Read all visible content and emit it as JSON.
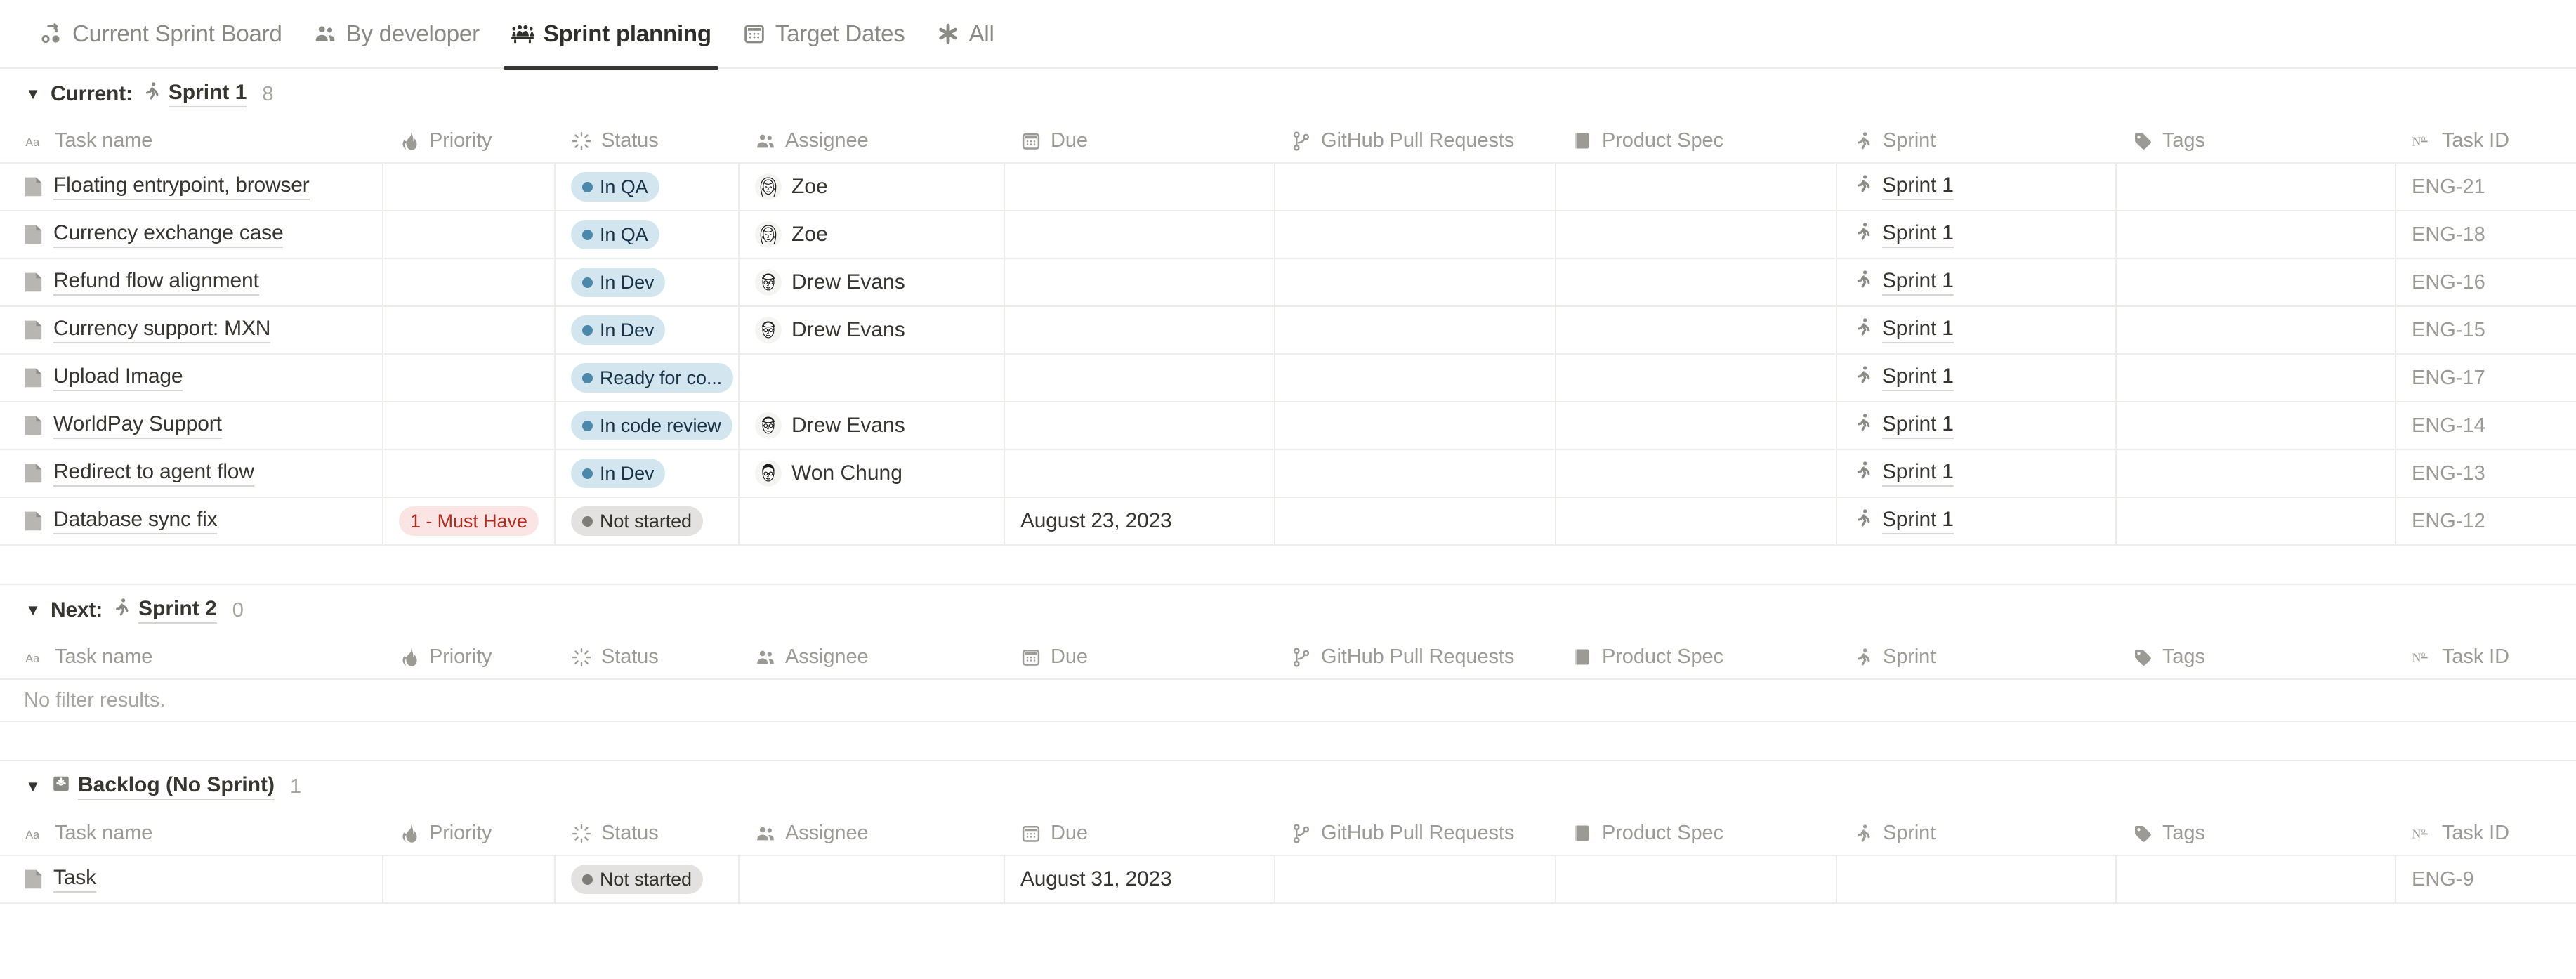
{
  "tabs": [
    {
      "label": "Current Sprint Board",
      "icon": "sprint-board-icon",
      "active": false
    },
    {
      "label": "By developer",
      "icon": "people-icon",
      "active": false
    },
    {
      "label": "Sprint planning",
      "icon": "meeting-icon",
      "active": true
    },
    {
      "label": "Target Dates",
      "icon": "calendar-icon",
      "active": false
    },
    {
      "label": "All",
      "icon": "asterisk-icon",
      "active": false
    }
  ],
  "columns": [
    {
      "key": "name",
      "label": "Task name",
      "icon": "aa-text-icon"
    },
    {
      "key": "priority",
      "label": "Priority",
      "icon": "flame-icon"
    },
    {
      "key": "status",
      "label": "Status",
      "icon": "spinner-icon"
    },
    {
      "key": "assignee",
      "label": "Assignee",
      "icon": "people-icon"
    },
    {
      "key": "due",
      "label": "Due",
      "icon": "calendar-icon"
    },
    {
      "key": "pr",
      "label": "GitHub Pull Requests",
      "icon": "git-branch-icon"
    },
    {
      "key": "spec",
      "label": "Product Spec",
      "icon": "book-icon"
    },
    {
      "key": "sprint",
      "label": "Sprint",
      "icon": "runner-icon"
    },
    {
      "key": "tags",
      "label": "Tags",
      "icon": "tag-icon"
    },
    {
      "key": "taskid",
      "label": "Task ID",
      "icon": "number-icon"
    }
  ],
  "colors": {
    "status_blue_bg": "#d3e5ef",
    "status_blue_text": "#183347",
    "status_blue_dot": "#4b88ab",
    "status_gray_bg": "#e3e2e0",
    "status_gray_text": "#32302c",
    "status_gray_dot": "#7e7d78",
    "priority_red_bg": "#fbe4e4",
    "priority_red_text": "#ad2f24",
    "grid_line": "#edecea",
    "muted_text": "#9b9a95",
    "active_tab": "#37352f"
  },
  "sections": [
    {
      "id": "current",
      "prefix": "Current:",
      "group_icon": "runner-icon",
      "group_name": "Sprint 1",
      "count": "8",
      "empty_text": null,
      "rows": [
        {
          "name": "Floating entrypoint, browser",
          "priority": null,
          "status": "In QA",
          "status_style": "blue",
          "assignee": "Zoe",
          "assignee_avatar": "female-long-hair",
          "due": "",
          "pr": "",
          "spec": "",
          "sprint": "Sprint 1",
          "tags": "",
          "taskid": "ENG-21"
        },
        {
          "name": "Currency exchange case",
          "priority": null,
          "status": "In QA",
          "status_style": "blue",
          "assignee": "Zoe",
          "assignee_avatar": "female-long-hair",
          "due": "",
          "pr": "",
          "spec": "",
          "sprint": "Sprint 1",
          "tags": "",
          "taskid": "ENG-18"
        },
        {
          "name": "Refund flow alignment",
          "priority": null,
          "status": "In Dev",
          "status_style": "blue",
          "assignee": "Drew Evans",
          "assignee_avatar": "male-glasses",
          "due": "",
          "pr": "",
          "spec": "",
          "sprint": "Sprint 1",
          "tags": "",
          "taskid": "ENG-16"
        },
        {
          "name": "Currency support: MXN",
          "priority": null,
          "status": "In Dev",
          "status_style": "blue",
          "assignee": "Drew Evans",
          "assignee_avatar": "male-glasses",
          "due": "",
          "pr": "",
          "spec": "",
          "sprint": "Sprint 1",
          "tags": "",
          "taskid": "ENG-15"
        },
        {
          "name": "Upload Image",
          "priority": null,
          "status": "Ready for co...",
          "status_style": "blue",
          "assignee": "",
          "assignee_avatar": null,
          "due": "",
          "pr": "",
          "spec": "",
          "sprint": "Sprint 1",
          "tags": "",
          "taskid": "ENG-17"
        },
        {
          "name": "WorldPay Support",
          "priority": null,
          "status": "In code review",
          "status_style": "blue",
          "assignee": "Drew Evans",
          "assignee_avatar": "male-glasses",
          "due": "",
          "pr": "",
          "spec": "",
          "sprint": "Sprint 1",
          "tags": "",
          "taskid": "ENG-14"
        },
        {
          "name": "Redirect to agent flow",
          "priority": null,
          "status": "In Dev",
          "status_style": "blue",
          "assignee": "Won Chung",
          "assignee_avatar": "male-dark-hair",
          "due": "",
          "pr": "",
          "spec": "",
          "sprint": "Sprint 1",
          "tags": "",
          "taskid": "ENG-13"
        },
        {
          "name": "Database sync fix",
          "priority": "1 - Must Have",
          "status": "Not started",
          "status_style": "gray",
          "assignee": "",
          "assignee_avatar": null,
          "due": "August 23, 2023",
          "pr": "",
          "spec": "",
          "sprint": "Sprint 1",
          "tags": "",
          "taskid": "ENG-12"
        }
      ]
    },
    {
      "id": "next",
      "prefix": "Next:",
      "group_icon": "runner-icon",
      "group_name": "Sprint 2",
      "count": "0",
      "empty_text": "No filter results.",
      "rows": []
    },
    {
      "id": "backlog",
      "prefix": null,
      "group_icon": "inbox-icon",
      "group_name": "Backlog (No Sprint)",
      "count": "1",
      "empty_text": null,
      "rows": [
        {
          "name": "Task",
          "priority": null,
          "status": "Not started",
          "status_style": "gray",
          "assignee": "",
          "assignee_avatar": null,
          "due": "August 31, 2023",
          "pr": "",
          "spec": "",
          "sprint": "",
          "tags": "",
          "taskid": "ENG-9"
        }
      ]
    }
  ]
}
